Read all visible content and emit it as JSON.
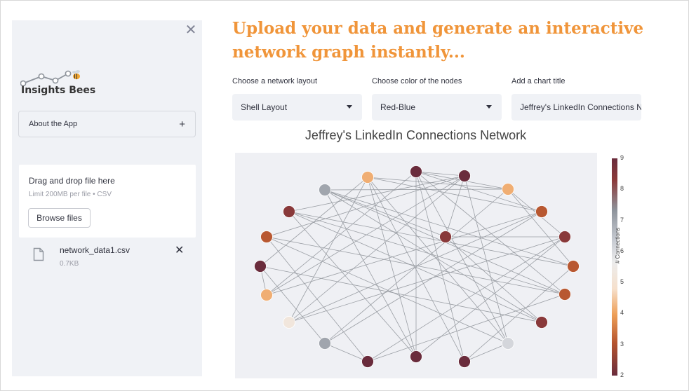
{
  "sidebar": {
    "close_icon": "✕",
    "logo_text": "Insights Bees",
    "about_label": "About the App",
    "about_icon": "+",
    "uploader": {
      "title": "Drag and drop file here",
      "limit": "Limit 200MB per file • CSV",
      "browse_label": "Browse files"
    },
    "file": {
      "name": "network_data1.csv",
      "size": "0.7KB",
      "remove_icon": "✕"
    }
  },
  "main": {
    "headline": "Upload your data and generate an interactive network graph instantly...",
    "layout_label": "Choose a network layout",
    "layout_value": "Shell Layout",
    "color_label": "Choose color of the nodes",
    "color_value": "Red-Blue",
    "title_label": "Add a chart title",
    "title_value": "Jeffrey's LinkedIn Connections Network"
  },
  "chart_data": {
    "type": "network",
    "title": "Jeffrey's LinkedIn Connections Network",
    "colorbar_title": "# Connections",
    "colorbar_ticks": [
      2,
      3,
      4,
      5,
      6,
      7,
      8,
      9
    ],
    "colorbar_range": [
      2,
      9
    ],
    "node_connections": [
      9,
      5,
      9,
      8,
      5,
      3,
      4,
      4,
      3,
      9,
      4,
      5,
      4,
      6,
      3,
      8,
      7,
      9,
      9,
      9,
      3
    ],
    "edges": [
      [
        0,
        2
      ],
      [
        0,
        4
      ],
      [
        0,
        6
      ],
      [
        0,
        11
      ],
      [
        0,
        16
      ],
      [
        0,
        18
      ],
      [
        0,
        19
      ],
      [
        0,
        12
      ],
      [
        1,
        4
      ],
      [
        1,
        6
      ],
      [
        1,
        9
      ],
      [
        1,
        13
      ],
      [
        1,
        16
      ],
      [
        1,
        18
      ],
      [
        1,
        19
      ],
      [
        2,
        5
      ],
      [
        2,
        7
      ],
      [
        2,
        11
      ],
      [
        2,
        13
      ],
      [
        2,
        16
      ],
      [
        2,
        20
      ],
      [
        3,
        4
      ],
      [
        3,
        10
      ],
      [
        3,
        12
      ],
      [
        3,
        14
      ],
      [
        3,
        19
      ],
      [
        3,
        20
      ],
      [
        4,
        8
      ],
      [
        4,
        10
      ],
      [
        4,
        15
      ],
      [
        5,
        10
      ],
      [
        5,
        12
      ],
      [
        5,
        14
      ],
      [
        5,
        19
      ],
      [
        6,
        15
      ],
      [
        6,
        11
      ],
      [
        6,
        13
      ],
      [
        7,
        12
      ],
      [
        7,
        16
      ],
      [
        7,
        17
      ],
      [
        8,
        13
      ],
      [
        8,
        19
      ],
      [
        8,
        17
      ],
      [
        8,
        20
      ],
      [
        9,
        14
      ],
      [
        9,
        11
      ],
      [
        9,
        15
      ],
      [
        10,
        18
      ],
      [
        12,
        17
      ],
      [
        14,
        20
      ],
      [
        15,
        17
      ],
      [
        16,
        18
      ]
    ],
    "colors": {
      "dark_red": "#6e2f3f",
      "rust": "#b5542f",
      "orange": "#ee9f57",
      "peach": "#f8e0cb",
      "light_gray": "#e5e7eb",
      "gray": "#c8ccd3",
      "slate": "#8e949c",
      "edge": "#9a9ea4"
    }
  },
  "colors": {
    "accent": "#f0953a",
    "sidebar_bg": "#f0f2f6",
    "plot_bg": "#eff0f4"
  }
}
